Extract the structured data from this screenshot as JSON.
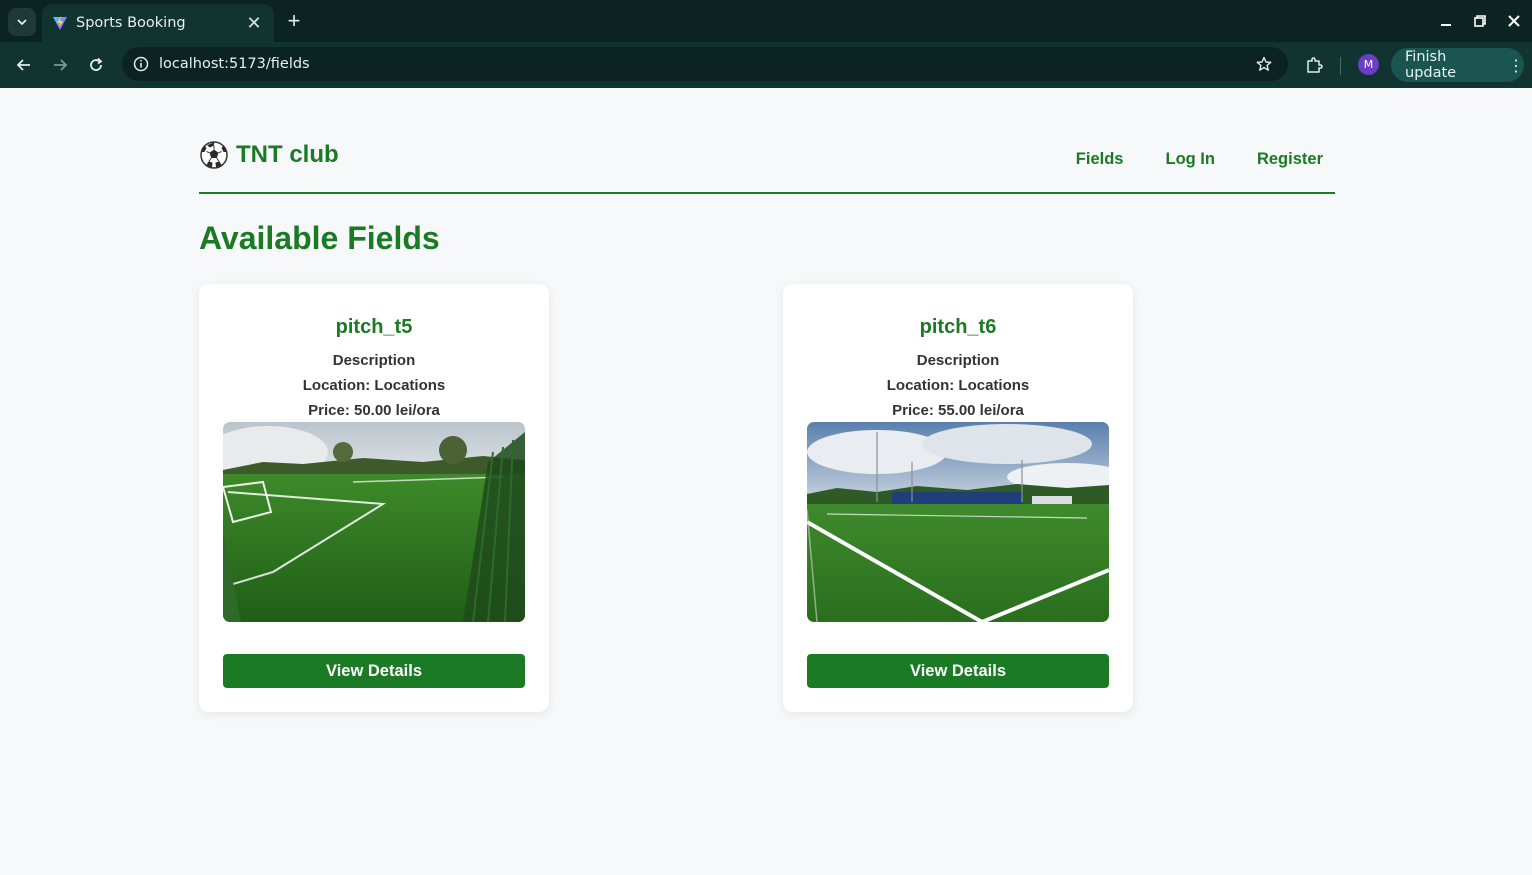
{
  "browser": {
    "tab_title": "Sports Booking",
    "tab_close": "✕",
    "new_tab": "+",
    "url": "localhost:5173/fields",
    "profile_initial": "M",
    "finish_update_label": "Finish update",
    "kebab": "⋮"
  },
  "site": {
    "logo_text": "TNT club",
    "logo_icon": "soccer-ball-icon",
    "nav": {
      "fields": "Fields",
      "login": "Log In",
      "register": "Register"
    }
  },
  "page": {
    "title": "Available Fields"
  },
  "fields": [
    {
      "name": "pitch_t5",
      "description": "Description",
      "location": "Location: Locations",
      "price": "Price: 50.00 lei/ora",
      "button_label": "View Details"
    },
    {
      "name": "pitch_t6",
      "description": "Description",
      "location": "Location: Locations",
      "price": "Price: 55.00 lei/ora",
      "button_label": "View Details"
    }
  ],
  "colors": {
    "brand_green": "#1b7a24",
    "page_bg": "#f6f8f9",
    "chrome_dark": "#0b2421",
    "chrome_toolbar": "#113430"
  }
}
